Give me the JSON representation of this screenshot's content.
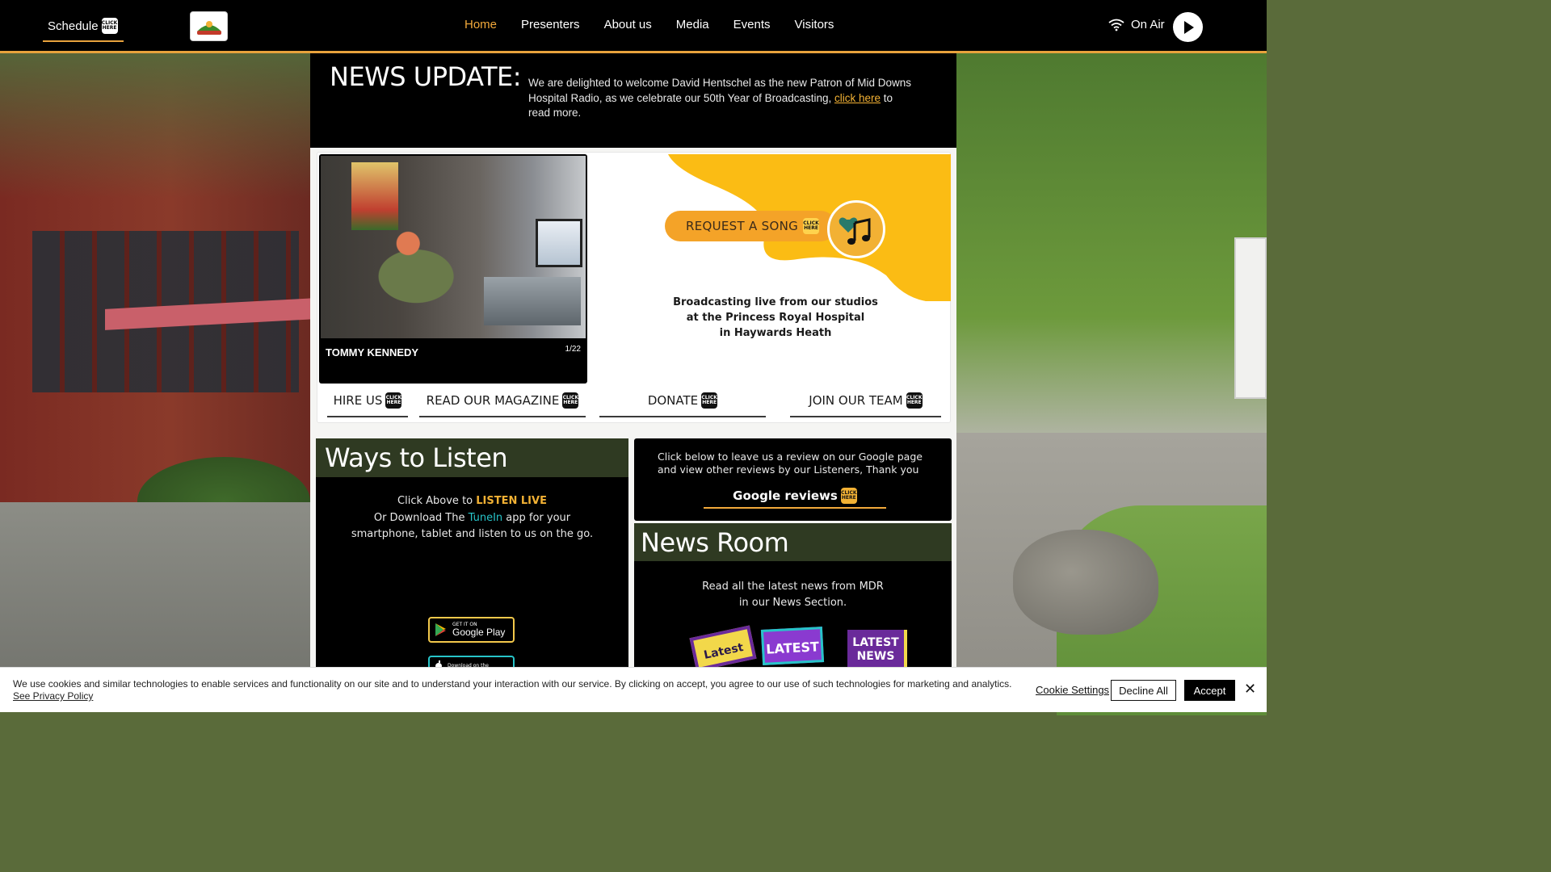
{
  "header": {
    "schedule_label": "Schedule",
    "click_here": "CLICK HERE",
    "nav": [
      {
        "label": "Home",
        "active": true
      },
      {
        "label": "Presenters",
        "active": false
      },
      {
        "label": "About us",
        "active": false
      },
      {
        "label": "Media",
        "active": false
      },
      {
        "label": "Events",
        "active": false
      },
      {
        "label": "Visitors",
        "active": false
      }
    ],
    "on_air_label": "On Air",
    "accent_color": "#e8a23c"
  },
  "news_update": {
    "title": "NEWS UPDATE:",
    "text_before": "We are delighted to welcome David Hentschel as the new Patron of Mid Downs Hospital Radio, as we celebrate our 50th Year of Broadcasting, ",
    "link": "click here",
    "text_after": " to read more."
  },
  "slideshow": {
    "caption": "TOMMY KENNEDY",
    "counter": "1/22"
  },
  "request": {
    "label": "REQUEST A SONG",
    "accent_color": "#f4a328"
  },
  "broadcast": {
    "line1": "Broadcasting live from our studios",
    "line2": "at the Princess Royal Hospital",
    "line3": "in Haywards Heath"
  },
  "cta": [
    {
      "label": "HIRE US"
    },
    {
      "label": "READ OUR MAGAZINE"
    },
    {
      "label": "DONATE"
    },
    {
      "label": "JOIN OUR TEAM"
    }
  ],
  "listen": {
    "title": "Ways to Listen",
    "line1_prefix": "Click Above to ",
    "line1_highlight": "LISTEN LIVE",
    "line2_prefix": "Or Download The ",
    "line2_highlight": "TuneIn",
    "line2_suffix": " app for your",
    "line3": "smartphone, tablet  and listen to us on the go.",
    "google_play_small": "GET IT ON",
    "google_play_big": "Google Play",
    "app_store_small": "Download on the"
  },
  "reviews": {
    "text": "Click below to leave us a review on our Google page and view other reviews by our Listeners, Thank you",
    "button_label": "Google reviews"
  },
  "newsroom": {
    "title": "News Room",
    "line1": "Read all the latest news from MDR",
    "line2": "in our News Section.",
    "stickers": [
      "Latest",
      "LATEST",
      "LATEST NEWS"
    ]
  },
  "cookie": {
    "text": "We use cookies and similar technologies to enable services and functionality on our site and to understand your interaction with our service. By clicking on accept, you agree to our use of such technologies for marketing and analytics.",
    "policy_link": "See Privacy Policy",
    "settings_label": "Cookie Settings",
    "decline_label": "Decline All",
    "accept_label": "Accept",
    "close_symbol": "✕"
  }
}
